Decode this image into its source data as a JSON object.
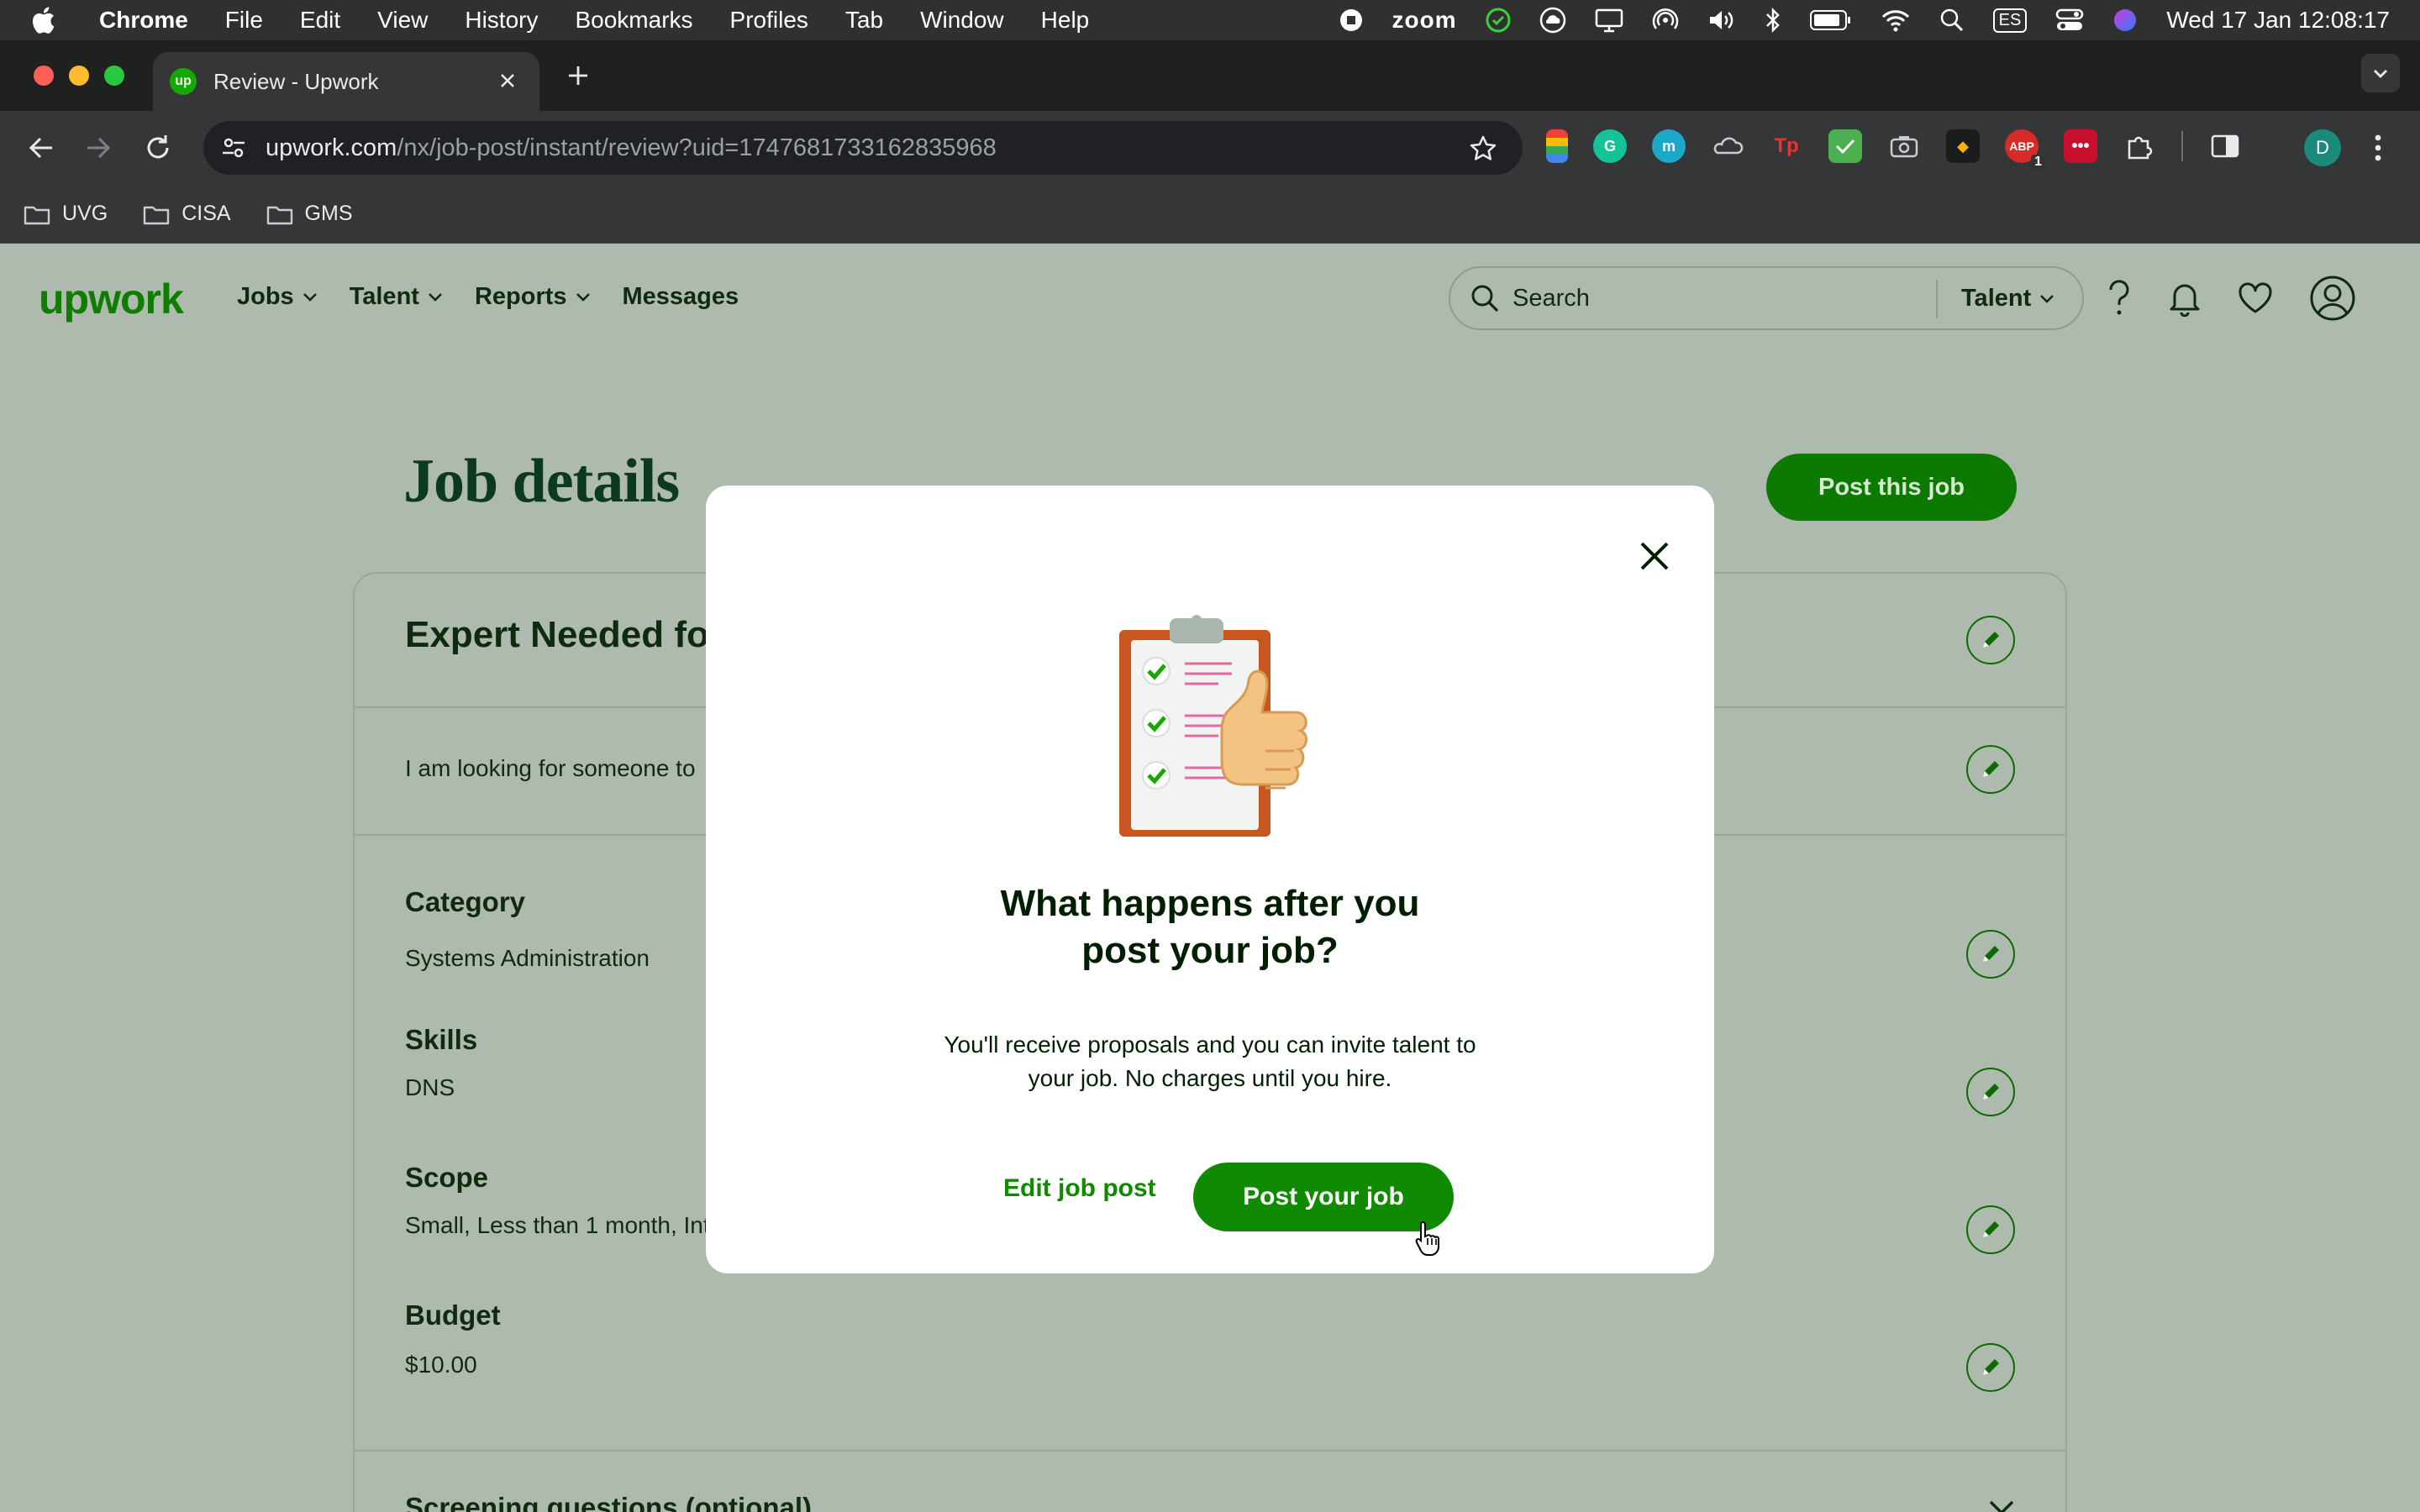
{
  "menubar": {
    "app": "Chrome",
    "items": [
      "File",
      "Edit",
      "View",
      "History",
      "Bookmarks",
      "Profiles",
      "Tab",
      "Window",
      "Help"
    ],
    "zoom_label": "zoom",
    "input_source": "ES",
    "datetime": "Wed 17 Jan  12:08:17"
  },
  "browser": {
    "tab_title": "Review - Upwork",
    "tab_favicon": "up",
    "url_host": "upwork.com",
    "url_path": "/nx/job-post/instant/review?uid=1747681733162835968",
    "profile_initial": "D",
    "ext_badge": "1",
    "bookmarks": [
      "UVG",
      "CISA",
      "GMS"
    ]
  },
  "site": {
    "logo": "upwork",
    "nav": [
      "Jobs",
      "Talent",
      "Reports",
      "Messages"
    ],
    "search_placeholder": "Search",
    "search_scope": "Talent"
  },
  "page": {
    "title": "Job details",
    "post_button": "Post this job",
    "job_heading": "Expert Needed for",
    "job_description": "I am looking for someone to",
    "category_label": "Category",
    "category_value": "Systems Administration",
    "skills_label": "Skills",
    "skills_value": "DNS",
    "scope_label": "Scope",
    "scope_value": "Small, Less than 1 month, Int",
    "budget_label": "Budget",
    "budget_value": "$10.00",
    "screening_label": "Screening questions (optional)"
  },
  "modal": {
    "heading_line1": "What happens after you",
    "heading_line2": "post your job?",
    "body_line1": "You'll receive proposals and you can invite talent to",
    "body_line2": "your job. No charges until you hire.",
    "edit_label": "Edit job post",
    "post_label": "Post your job"
  },
  "colors": {
    "brand_green": "#108a00",
    "overlay_page": "#aebaae",
    "menubar": "#2f3030",
    "toolbar": "#353637"
  }
}
